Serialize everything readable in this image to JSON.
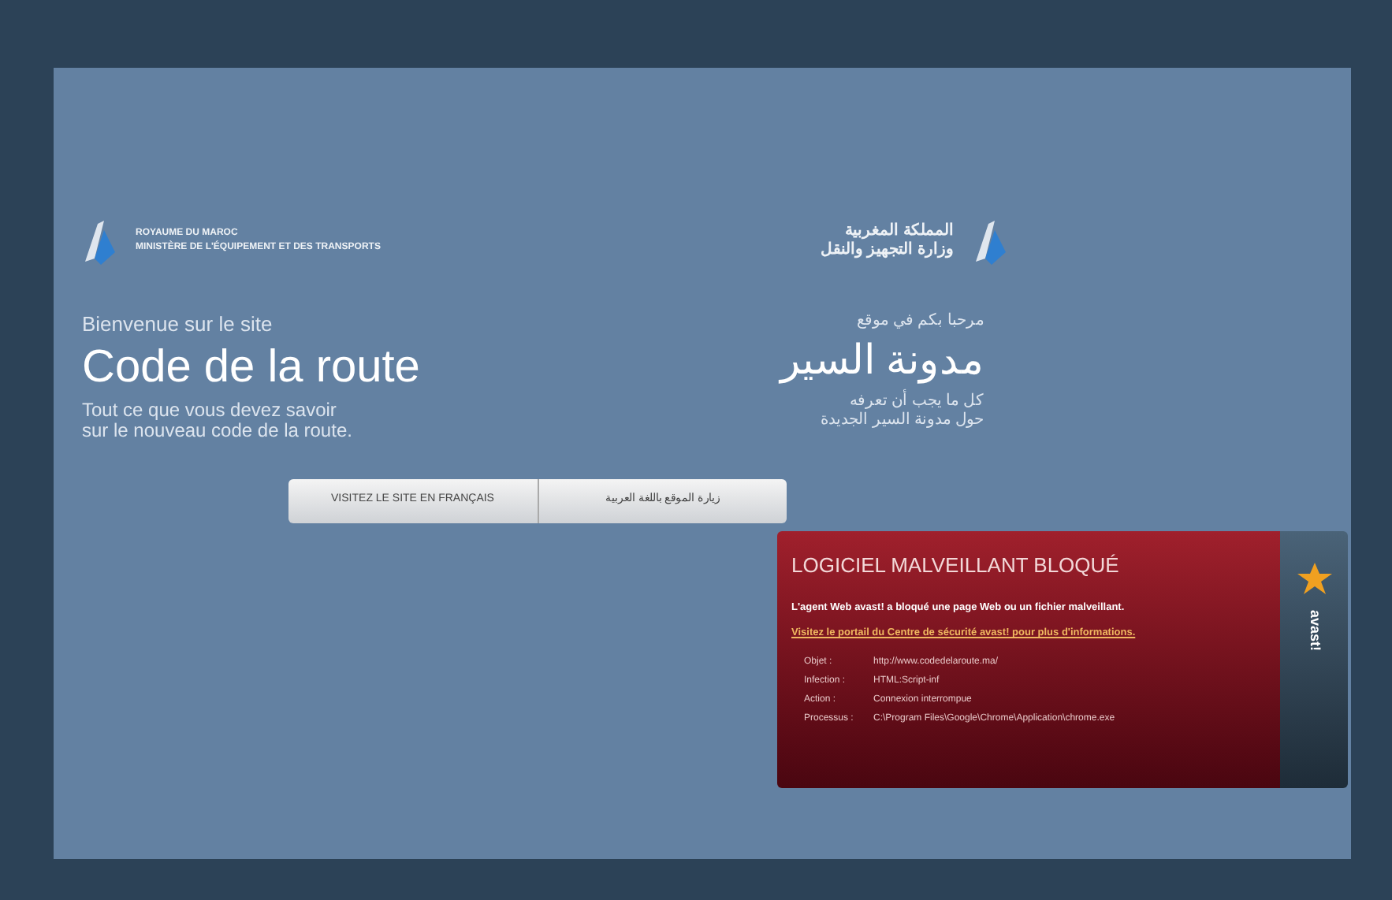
{
  "header": {
    "left": {
      "line_1": "ROYAUME DU MAROC",
      "line_2": "MINISTÈRE DE L'ÉQUIPEMENT ET DES TRANSPORTS"
    },
    "right": {
      "line_1": "المملكة المغربية",
      "line_2": "وزارة التجهيز والنقل"
    }
  },
  "intro_fr": {
    "welcome": "Bienvenue sur le site",
    "title": "Code de la route",
    "subtitle_1": "Tout ce que vous devez savoir",
    "subtitle_2": "sur le nouveau code de la route."
  },
  "intro_ar": {
    "welcome": "مرحبا بكم في موقع",
    "title": "مدونة السير",
    "subtitle_1": "كل ما يجب أن تعرفه",
    "subtitle_2": "حول مدونة السير الجديدة"
  },
  "buttons": [
    "VISITEZ LE SITE EN FRANÇAIS",
    "زيارة الموقع باللغة العربية"
  ],
  "alert": {
    "title": "LOGICIEL MALVEILLANT BLOQUÉ",
    "message": "L'agent Web avast! a bloqué une page Web ou un fichier malveillant.",
    "link": "Visitez le portail du Centre de sécurité avast! pour plus d'informations.",
    "details": [
      {
        "label": "Objet :",
        "value": "http://www.codedelaroute.ma/"
      },
      {
        "label": "Infection :",
        "value": "HTML:Script-inf"
      },
      {
        "label": "Action :",
        "value": "Connexion interrompue"
      },
      {
        "label": "Processus :",
        "value": "C:\\Program Files\\Google\\Chrome\\Application\\chrome.exe"
      }
    ],
    "brand": "avast!"
  }
}
